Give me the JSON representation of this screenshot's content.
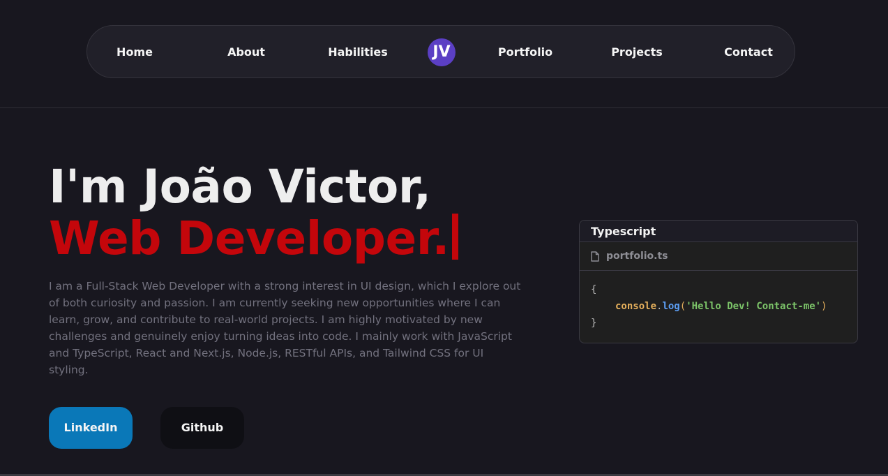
{
  "nav": {
    "links": [
      {
        "label": "Home"
      },
      {
        "label": "About"
      },
      {
        "label": "Habilities"
      },
      {
        "label": "Portfolio"
      },
      {
        "label": "Projects"
      },
      {
        "label": "Contact"
      }
    ],
    "logo": "JV",
    "logo_color": "#5b3fc4"
  },
  "hero": {
    "title": "I'm João Victor,",
    "role": "Web Developer.",
    "role_color": "#c4060b",
    "description": "I am a Full-Stack Web Developer with a strong interest in UI design, which I explore out of both curiosity and passion. I am currently seeking new opportunities where I can learn, grow, and contribute to real-world projects. I am highly motivated by new challenges and genuinely enjoy turning ideas into code. I mainly work with JavaScript and TypeScript, React and Next.js, Node.js, RESTful APIs, and Tailwind CSS for UI styling."
  },
  "buttons": {
    "linkedin": "LinkedIn",
    "github": "Github",
    "linkedin_color": "#0a78b8"
  },
  "code_card": {
    "title": "Typescript",
    "filename": "portfolio.ts",
    "file_icon": "file-icon",
    "code": {
      "open_brace": "{",
      "object": "console",
      "dot": ".",
      "method": "log",
      "paren_open": "(",
      "string": "'Hello Dev! Contact-me'",
      "paren_close": ")",
      "close_brace": "}"
    }
  }
}
